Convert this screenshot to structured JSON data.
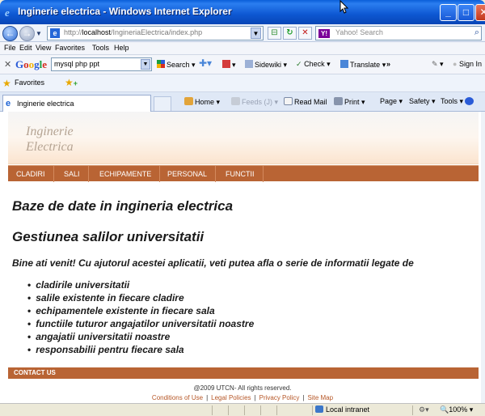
{
  "window": {
    "title": "Inginerie electrica - Windows Internet Explorer",
    "buttons": {
      "minimize": "_",
      "maximize": "□",
      "close": "✕"
    }
  },
  "address_bar": {
    "url_prefix": "http://",
    "url_host": "localhost",
    "url_path": "/IngineriaElectrica/index.php"
  },
  "search": {
    "placeholder": "Yahoo! Search",
    "provider_icon": "Y!"
  },
  "menu": [
    "File",
    "Edit",
    "View",
    "Favorites",
    "Tools",
    "Help"
  ],
  "google_toolbar": {
    "logo": "Google",
    "query": "mysql php ppt",
    "search_label": "Search",
    "sidewiki_label": "Sidewiki",
    "check_label": "Check",
    "translate_label": "Translate",
    "more_label": "»",
    "signin_label": "Sign In"
  },
  "favorites_bar": {
    "label": "Favorites"
  },
  "tab": {
    "label": "Inginerie electrica"
  },
  "command_bar": {
    "home": "Home",
    "feeds": "Feeds (J)",
    "read_mail": "Read Mail",
    "print": "Print",
    "page": "Page",
    "safety": "Safety",
    "tools": "Tools",
    "help": "Help"
  },
  "site": {
    "logo_line1": "Inginerie",
    "logo_line2": "Electrica",
    "nav": [
      "CLADIRI",
      "SALI",
      "ECHIPAMENTE",
      "PERSONAL",
      "FUNCTII"
    ],
    "heading1": "Baze de date in ingineria electrica",
    "heading2": "Gestiunea salilor universitatii",
    "intro": "Bine ati venit! Cu ajutorul acestei aplicatii, veti putea afla o serie de informatii legate de",
    "bullets": [
      "cladirile universitatii",
      "salile existente in fiecare cladire",
      "echipamentele existente in fiecare sala",
      "functiile tuturor angajatilor universitatii noastre",
      "angajatii universitatii noastre",
      "responsabilii pentru fiecare sala"
    ],
    "contact": "CONTACT US",
    "copyright": "@2009 UTCN- All rights reserved.",
    "footer_links": [
      "Conditions of Use",
      "Legal Policies",
      "Privacy Policy",
      "Site Map"
    ]
  },
  "status_bar": {
    "zone": "Local intranet",
    "zoom": "100%"
  },
  "colors": {
    "nav_brown": "#b96434",
    "link_orange": "#b65626",
    "titlebar_blue": "#0d57d2"
  }
}
